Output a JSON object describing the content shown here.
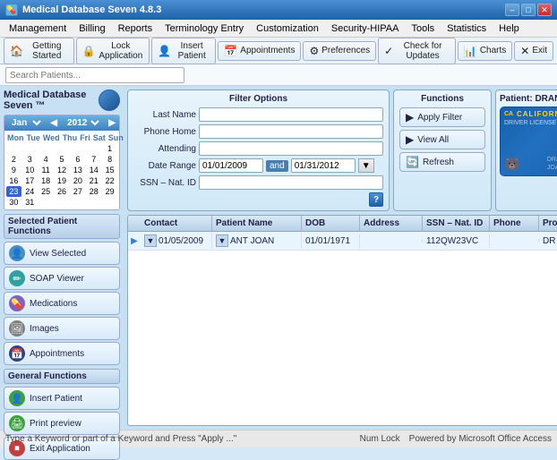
{
  "titleBar": {
    "title": "Medical Database Seven 4.8.3",
    "icon": "💊",
    "controls": {
      "minimize": "–",
      "maximize": "□",
      "close": "✕"
    }
  },
  "menuBar": {
    "items": [
      "Management",
      "Billing",
      "Reports",
      "Terminology Entry",
      "Customization",
      "Security-HIPAA",
      "Tools",
      "Statistics",
      "Help"
    ]
  },
  "toolbar": {
    "buttons": [
      {
        "id": "getting-started",
        "icon": "🏠",
        "label": "Getting Started"
      },
      {
        "id": "lock-application",
        "icon": "🔒",
        "label": "Lock Application"
      },
      {
        "id": "insert-patient",
        "icon": "👤",
        "label": "Insert Patient"
      },
      {
        "id": "appointments",
        "icon": "📅",
        "label": "Appointments"
      },
      {
        "id": "preferences",
        "icon": "⚙",
        "label": "Preferences"
      },
      {
        "id": "check-updates",
        "icon": "✓",
        "label": "Check for Updates"
      },
      {
        "id": "charts",
        "icon": "📊",
        "label": "Charts"
      },
      {
        "id": "exit",
        "icon": "✕",
        "label": "Exit"
      }
    ]
  },
  "searchBar": {
    "placeholder": "Search Patients..."
  },
  "calendar": {
    "month": "Jan",
    "year": "2012",
    "dayHeaders": [
      "Mon",
      "Tue",
      "Wed",
      "Thu",
      "Fri",
      "Sat",
      "Sun"
    ],
    "weeks": [
      [
        "",
        "",
        "",
        "",
        "",
        "",
        "1"
      ],
      [
        "2",
        "3",
        "4",
        "5",
        "6",
        "7",
        "8"
      ],
      [
        "9",
        "10",
        "11",
        "12",
        "13",
        "14",
        "15"
      ],
      [
        "16",
        "17",
        "18",
        "19",
        "20",
        "21",
        "22"
      ],
      [
        "23",
        "24",
        "25",
        "26",
        "27",
        "28",
        "29"
      ],
      [
        "30",
        "31",
        "",
        "",
        "",
        "",
        ""
      ]
    ]
  },
  "appTitle": "Medical Database Seven ™",
  "selectedPatientFunctions": {
    "header": "Selected Patient Functions",
    "buttons": [
      {
        "id": "view-selected",
        "icon": "👤",
        "label": "View Selected",
        "color": "blue"
      },
      {
        "id": "soap-viewer",
        "icon": "✏",
        "label": "SOAP Viewer",
        "color": "teal"
      },
      {
        "id": "medications",
        "icon": "💊",
        "label": "Medications",
        "color": "purple"
      },
      {
        "id": "images",
        "icon": "🖼",
        "label": "Images",
        "color": "gray"
      },
      {
        "id": "appointments",
        "icon": "📅",
        "label": "Appointments",
        "color": "navy"
      }
    ]
  },
  "generalFunctions": {
    "header": "General Functions",
    "buttons": [
      {
        "id": "insert-patient",
        "icon": "👤",
        "label": "Insert Patient",
        "color": "green"
      },
      {
        "id": "print-preview",
        "icon": "🖨",
        "label": "Print preview",
        "color": "green"
      },
      {
        "id": "exit-app",
        "icon": "⏹",
        "label": "Exit Application",
        "color": "red"
      }
    ]
  },
  "filterPanel": {
    "title": "Filter Options",
    "fields": [
      {
        "id": "last-name",
        "label": "Last Name",
        "value": ""
      },
      {
        "id": "phone-home",
        "label": "Phone Home",
        "value": ""
      },
      {
        "id": "attending",
        "label": "Attending",
        "value": ""
      }
    ],
    "dateRange": {
      "label": "Date Range",
      "from": "01/01/2009",
      "and": "and",
      "to": "01/31/2012"
    },
    "ssnField": {
      "label": "SSN – Nat. ID",
      "value": ""
    },
    "helpTooltip": "?"
  },
  "functionsPanel": {
    "title": "Functions",
    "buttons": [
      {
        "id": "apply-filter",
        "label": "Apply Filter",
        "icon": "▶"
      },
      {
        "id": "view-all",
        "label": "View All",
        "icon": "▶"
      },
      {
        "id": "refresh",
        "label": "Refresh",
        "icon": "🔄"
      }
    ]
  },
  "patientCard": {
    "label": "Patient: DRANT JOAN",
    "stateLabel": "CALIFORNIA",
    "dlLabel": "DRIVER LICENSE",
    "bearEmoji": "🐻"
  },
  "resultsTable": {
    "columns": [
      {
        "id": "contact",
        "label": "Contact"
      },
      {
        "id": "patient-name",
        "label": "Patient Name"
      },
      {
        "id": "dob",
        "label": "DOB"
      },
      {
        "id": "address",
        "label": "Address"
      },
      {
        "id": "ssn-nat-id",
        "label": "SSN – Nat. ID"
      },
      {
        "id": "phone",
        "label": "Phone"
      },
      {
        "id": "provider",
        "label": "Provider"
      }
    ],
    "rows": [
      {
        "contact": "01/05/2009",
        "patientName": "ANT JOAN",
        "dob": "01/01/1971",
        "address": "",
        "ssn": "112QW23VC",
        "phone": "",
        "provider": "DR Forge Sami"
      }
    ]
  },
  "statusBar": {
    "left": "Type a Keyword or part of a Keyword and Press \"Apply ...\"",
    "numLock": "Num Lock",
    "right": "Powered by Microsoft Office Access"
  }
}
